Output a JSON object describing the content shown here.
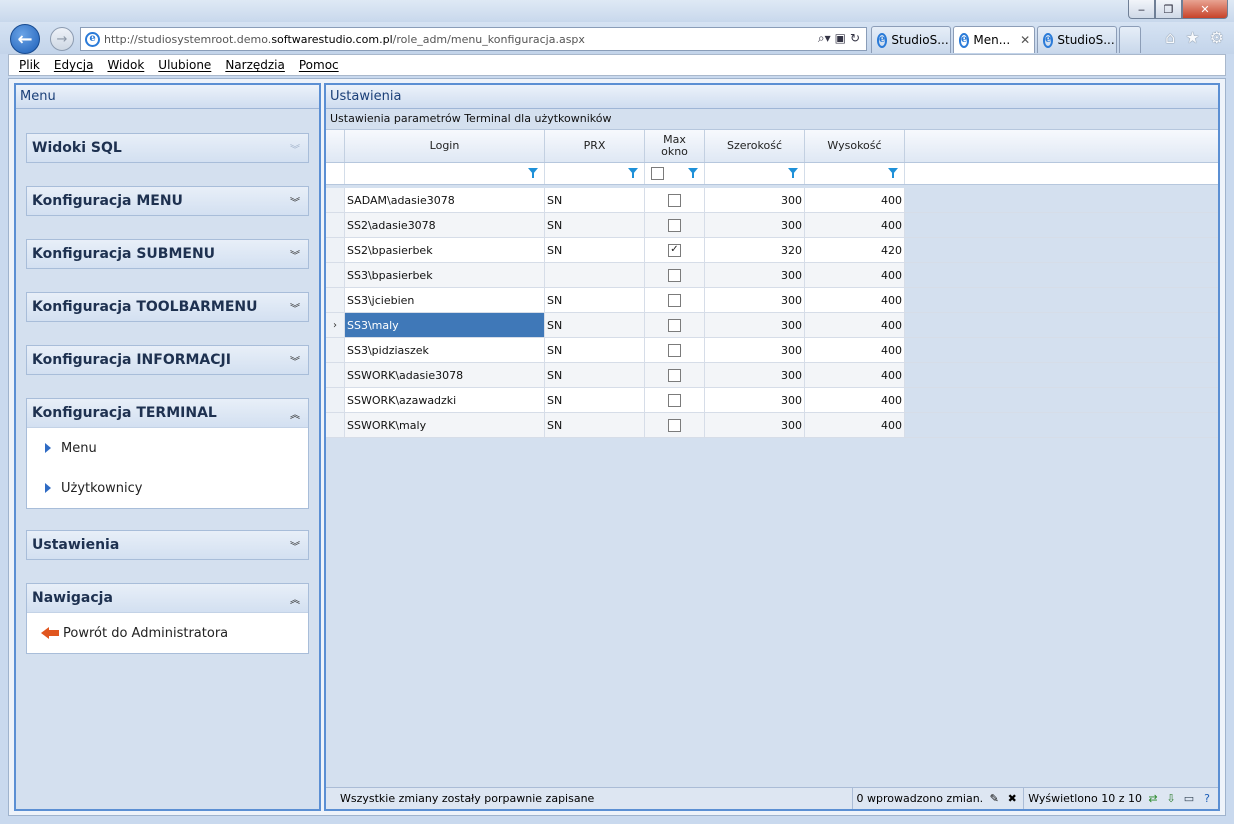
{
  "browser": {
    "url_prefix": "http://studiosystemroot.demo.",
    "url_host": "softwarestudio.com.pl",
    "url_path": "/role_adm/menu_konfiguracja.aspx",
    "tabs": [
      {
        "label": "StudioS..."
      },
      {
        "label": "Men..."
      },
      {
        "label": "StudioS..."
      }
    ],
    "menu": [
      "Plik",
      "Edycja",
      "Widok",
      "Ulubione",
      "Narzędzia",
      "Pomoc"
    ]
  },
  "left_panel": {
    "title": "Menu",
    "sections": [
      {
        "label": "Widoki SQL"
      },
      {
        "label": "Konfiguracja MENU"
      },
      {
        "label": "Konfiguracja SUBMENU"
      },
      {
        "label": "Konfiguracja TOOLBARMENU"
      },
      {
        "label": "Konfiguracja INFORMACJI"
      },
      {
        "label": "Konfiguracja TERMINAL",
        "items": [
          "Menu",
          "Użytkownicy"
        ]
      },
      {
        "label": "Ustawienia"
      },
      {
        "label": "Nawigacja",
        "items": [
          "Powrót do Administratora"
        ]
      }
    ]
  },
  "right_panel": {
    "title": "Ustawienia",
    "subtitle": "Ustawienia parametrów Terminal dla użytkowników",
    "columns": [
      "Login",
      "PRX",
      "Max okno",
      "Szerokość",
      "Wysokość"
    ],
    "rows": [
      {
        "login": "SADAM\\adasie3078",
        "prx": "SN",
        "max": false,
        "w": "300",
        "h": "400"
      },
      {
        "login": "SS2\\adasie3078",
        "prx": "SN",
        "max": false,
        "w": "300",
        "h": "400"
      },
      {
        "login": "SS2\\bpasierbek",
        "prx": "SN",
        "max": true,
        "w": "320",
        "h": "420"
      },
      {
        "login": "SS3\\bpasierbek",
        "prx": "",
        "max": false,
        "w": "300",
        "h": "400"
      },
      {
        "login": "SS3\\jciebien",
        "prx": "SN",
        "max": false,
        "w": "300",
        "h": "400"
      },
      {
        "login": "SS3\\maly",
        "prx": "SN",
        "max": false,
        "w": "300",
        "h": "400",
        "selected": true
      },
      {
        "login": "SS3\\pidziaszek",
        "prx": "SN",
        "max": false,
        "w": "300",
        "h": "400"
      },
      {
        "login": "SSWORK\\adasie3078",
        "prx": "SN",
        "max": false,
        "w": "300",
        "h": "400"
      },
      {
        "login": "SSWORK\\azawadzki",
        "prx": "SN",
        "max": false,
        "w": "300",
        "h": "400"
      },
      {
        "login": "SSWORK\\maly",
        "prx": "SN",
        "max": false,
        "w": "300",
        "h": "400"
      }
    ],
    "status": {
      "message": "Wszystkie zmiany zostały porpawnie zapisane",
      "changes": "0 wprowadzono zmian.",
      "count": "Wyświetlono 10 z 10"
    }
  },
  "colors": {
    "accent": "#5b8fd3",
    "selected": "#3f78b8",
    "filter_icon": "#1e90d8"
  }
}
